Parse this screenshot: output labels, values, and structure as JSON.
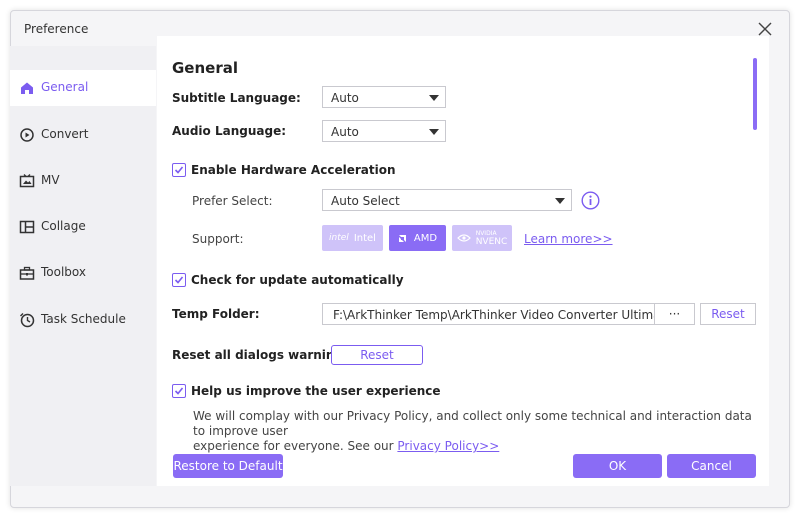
{
  "window": {
    "title": "Preference"
  },
  "sidebar": {
    "items": [
      {
        "label": "General",
        "icon": "home-icon"
      },
      {
        "label": "Convert",
        "icon": "convert-icon"
      },
      {
        "label": "MV",
        "icon": "mv-icon"
      },
      {
        "label": "Collage",
        "icon": "collage-icon"
      },
      {
        "label": "Toolbox",
        "icon": "toolbox-icon"
      },
      {
        "label": "Task Schedule",
        "icon": "clock-icon"
      }
    ]
  },
  "general": {
    "heading": "General",
    "subtitle_language": {
      "label": "Subtitle Language:",
      "value": "Auto"
    },
    "audio_language": {
      "label": "Audio Language:",
      "value": "Auto"
    },
    "hardware_acceleration": {
      "label": "Enable Hardware Acceleration",
      "checked": true,
      "prefer_label": "Prefer Select:",
      "prefer_value": "Auto Select",
      "support_label": "Support:",
      "chips": [
        {
          "brand": "intel",
          "text": "Intel",
          "enabled": false
        },
        {
          "brand": "AMD",
          "text": "AMD",
          "enabled": true
        },
        {
          "brand_top": "NVIDIA",
          "text": "NVENC",
          "enabled": false
        }
      ],
      "learn_more": "Learn more>>"
    },
    "check_update": {
      "label": "Check for update automatically",
      "checked": true
    },
    "temp_folder": {
      "label": "Temp Folder:",
      "path": "F:\\ArkThinker Temp\\ArkThinker Video Converter Ultimate",
      "browse": "···",
      "reset": "Reset"
    },
    "reset_dialogs": {
      "label": "Reset all dialogs warnings:",
      "button": "Reset"
    },
    "improve": {
      "label": "Help us improve the user experience",
      "checked": true,
      "line1": "We will complay with our Privacy Policy, and collect only some technical and interaction data to improve user",
      "line2": "experience for everyone. See our ",
      "policy_link": "Privacy Policy>>"
    }
  },
  "footer": {
    "restore": "Restore to Default",
    "ok": "OK",
    "cancel": "Cancel"
  },
  "colors": {
    "accent": "#8a6cf5",
    "accent_light": "#cfc3f9",
    "sidebar_bg": "#f0f0f3"
  }
}
